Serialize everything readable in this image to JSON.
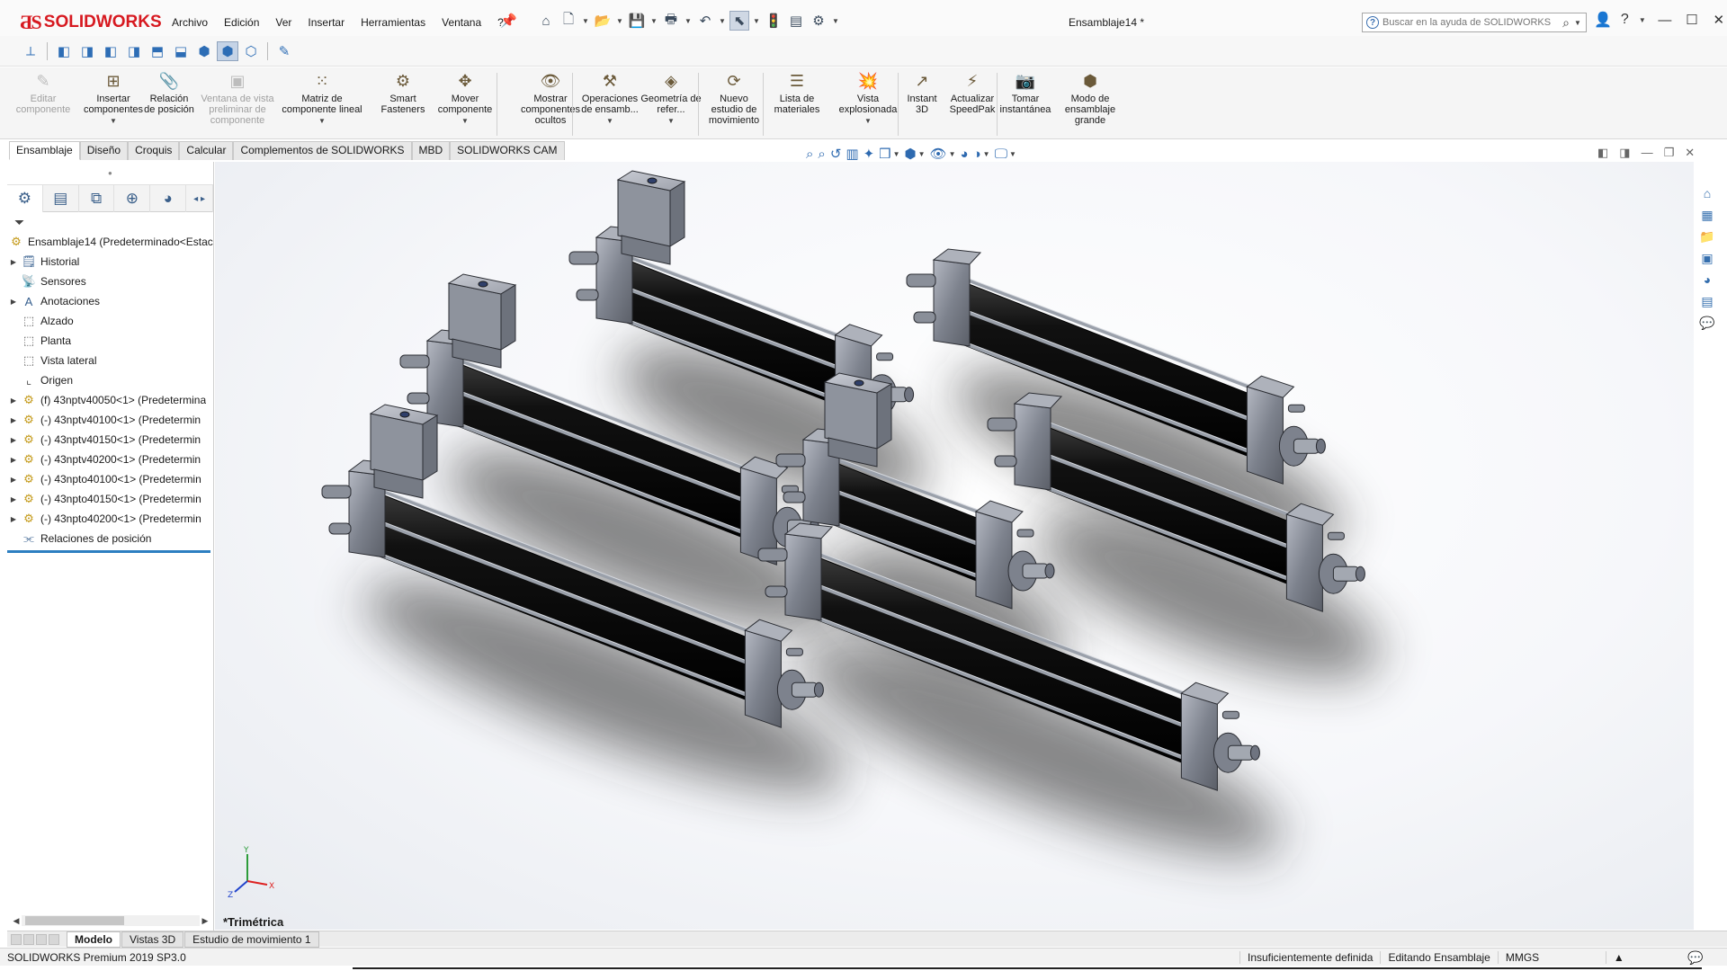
{
  "app": {
    "logo_mark": "ƋS",
    "logo_text": "SOLIDWORKS",
    "document_title": "Ensamblaje14 *"
  },
  "menu": [
    "Archivo",
    "Edición",
    "Ver",
    "Insertar",
    "Herramientas",
    "Ventana",
    "?"
  ],
  "search": {
    "placeholder": "Buscar en la ayuda de SOLIDWORKS"
  },
  "ribbon": [
    {
      "label": "Editar componente",
      "icon": "edit-component-icon",
      "enabled": false
    },
    {
      "label": "Insertar componentes",
      "icon": "insert-components-icon",
      "enabled": true,
      "dropdown": true
    },
    {
      "label": "Relación de posición",
      "icon": "mate-icon",
      "enabled": true
    },
    {
      "label": "Ventana de vista preliminar de componente",
      "icon": "component-preview-icon",
      "enabled": false
    },
    {
      "label": "Matriz de componente lineal",
      "icon": "linear-pattern-icon",
      "enabled": true,
      "dropdown": true
    },
    {
      "label": "Smart Fasteners",
      "icon": "smart-fasteners-icon",
      "enabled": true
    },
    {
      "label": "Mover componente",
      "icon": "move-component-icon",
      "enabled": true,
      "dropdown": true
    },
    {
      "label": "Mostrar componentes ocultos",
      "icon": "show-hidden-icon",
      "enabled": true
    },
    {
      "label": "Operaciones de ensamb...",
      "icon": "assembly-features-icon",
      "enabled": true,
      "dropdown": true
    },
    {
      "label": "Geometría de refer...",
      "icon": "reference-geometry-icon",
      "enabled": true,
      "dropdown": true
    },
    {
      "label": "Nuevo estudio de movimiento",
      "icon": "motion-study-icon",
      "enabled": true
    },
    {
      "label": "Lista de materiales",
      "icon": "bom-icon",
      "enabled": true
    },
    {
      "label": "Vista explosionada",
      "icon": "exploded-view-icon",
      "enabled": true,
      "dropdown": true
    },
    {
      "label": "Instant 3D",
      "icon": "instant3d-icon",
      "enabled": true
    },
    {
      "label": "Actualizar SpeedPak",
      "icon": "speedpak-icon",
      "enabled": true
    },
    {
      "label": "Tomar instantánea",
      "icon": "snapshot-icon",
      "enabled": true
    },
    {
      "label": "Modo de ensamblaje grande",
      "icon": "large-assembly-icon",
      "enabled": true
    }
  ],
  "tabs": [
    "Ensamblaje",
    "Diseño",
    "Croquis",
    "Calcular",
    "Complementos de SOLIDWORKS",
    "MBD",
    "SOLIDWORKS CAM"
  ],
  "active_tab": "Ensamblaje",
  "tree": {
    "root": "Ensamblaje14  (Predeterminado<Estac",
    "items": [
      {
        "label": "Historial",
        "expandable": true,
        "icon": "history-icon"
      },
      {
        "label": "Sensores",
        "expandable": false,
        "icon": "sensors-icon"
      },
      {
        "label": "Anotaciones",
        "expandable": true,
        "icon": "annotations-icon"
      },
      {
        "label": "Alzado",
        "expandable": false,
        "icon": "plane-icon"
      },
      {
        "label": "Planta",
        "expandable": false,
        "icon": "plane-icon"
      },
      {
        "label": "Vista lateral",
        "expandable": false,
        "icon": "plane-icon"
      },
      {
        "label": "Origen",
        "expandable": false,
        "icon": "origin-icon"
      },
      {
        "label": "(f) 43nptv40050<1> (Predetermina",
        "expandable": true,
        "icon": "part-icon"
      },
      {
        "label": "(-) 43nptv40100<1> (Predetermin",
        "expandable": true,
        "icon": "part-icon"
      },
      {
        "label": "(-) 43nptv40150<1> (Predetermin",
        "expandable": true,
        "icon": "part-icon"
      },
      {
        "label": "(-) 43nptv40200<1> (Predetermin",
        "expandable": true,
        "icon": "part-icon"
      },
      {
        "label": "(-) 43npto40100<1> (Predetermin",
        "expandable": true,
        "icon": "part-icon"
      },
      {
        "label": "(-) 43npto40150<1> (Predetermin",
        "expandable": true,
        "icon": "part-icon"
      },
      {
        "label": "(-) 43npto40200<1> (Predetermin",
        "expandable": true,
        "icon": "part-icon"
      },
      {
        "label": "Relaciones de posición",
        "expandable": false,
        "icon": "mates-icon"
      }
    ]
  },
  "viewport": {
    "view_name": "*Trimétrica",
    "cylinders": [
      {
        "name": "43nptv40050",
        "has_valve": true
      },
      {
        "name": "43nptv40100",
        "has_valve": true
      },
      {
        "name": "43nptv40150",
        "has_valve": true
      },
      {
        "name": "43nptv40200",
        "has_valve": true
      },
      {
        "name": "43npto40100",
        "has_valve": false
      },
      {
        "name": "43npto40150",
        "has_valve": false
      },
      {
        "name": "43npto40200",
        "has_valve": false
      }
    ],
    "colors": {
      "body": "#8a8f9a",
      "barrel": "#0a0a0a",
      "shadow": "#2a2a2a"
    }
  },
  "bottom_tabs": [
    "Modelo",
    "Vistas 3D",
    "Estudio de movimiento 1"
  ],
  "active_bottom_tab": "Modelo",
  "status": {
    "version": "SOLIDWORKS Premium 2019 SP3.0",
    "definition": "Insuficientemente definida",
    "mode": "Editando Ensamblaje",
    "units": "MMGS"
  }
}
